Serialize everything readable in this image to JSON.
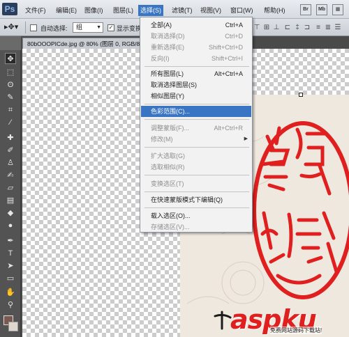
{
  "app": {
    "logo": "Ps"
  },
  "menubar": {
    "items": [
      "文件(F)",
      "编辑(E)",
      "图像(I)",
      "图层(L)",
      "选择(S)",
      "滤镜(T)",
      "视图(V)",
      "窗口(W)",
      "帮助(H)"
    ],
    "active_item": "选择(S)",
    "right_icons": [
      "Br",
      "Mb"
    ]
  },
  "options_bar": {
    "auto_select_label": "自动选择:",
    "group_select_value": "组",
    "show_transform_label": "显示变换控件",
    "show_transform_checked": true,
    "auto_select_checked": false
  },
  "document": {
    "tab_title": "80bOOOPICde.jpg @ 80% (图层 0, RGB/8)"
  },
  "select_menu": {
    "items": [
      {
        "label": "全部(A)",
        "shortcut": "Ctrl+A",
        "enabled": true
      },
      {
        "label": "取消选择(D)",
        "shortcut": "Ctrl+D",
        "enabled": false
      },
      {
        "label": "重新选择(E)",
        "shortcut": "Shift+Ctrl+D",
        "enabled": false
      },
      {
        "label": "反向(I)",
        "shortcut": "Shift+Ctrl+I",
        "enabled": false
      },
      {
        "label": "所有图层(L)",
        "shortcut": "Alt+Ctrl+A",
        "enabled": true
      },
      {
        "label": "取消选择图层(S)",
        "shortcut": "",
        "enabled": true
      },
      {
        "label": "相似图层(Y)",
        "shortcut": "",
        "enabled": true
      },
      {
        "label": "色彩范围(C)...",
        "shortcut": "",
        "enabled": true,
        "highlighted": true
      },
      {
        "label": "调整蒙版(F)...",
        "shortcut": "Alt+Ctrl+R",
        "enabled": false
      },
      {
        "label": "修改(M)",
        "shortcut": "",
        "enabled": false,
        "submenu": true
      },
      {
        "label": "扩大选取(G)",
        "shortcut": "",
        "enabled": false
      },
      {
        "label": "选取相似(R)",
        "shortcut": "",
        "enabled": false
      },
      {
        "label": "变换选区(T)",
        "shortcut": "",
        "enabled": false
      },
      {
        "label": "在快速蒙版模式下编辑(Q)",
        "shortcut": "",
        "enabled": true
      },
      {
        "label": "载入选区(O)...",
        "shortcut": "",
        "enabled": true
      },
      {
        "label": "存储选区(V)...",
        "shortcut": "",
        "enabled": false
      }
    ]
  },
  "watermark": {
    "logo": "aspku",
    "tagline": "免费网站源码下载站!"
  },
  "colors": {
    "foreground": "#7a5a4e",
    "background": "#e0d8cf",
    "menu_highlight": "#3a75c4",
    "seal_red": "#e01f1f"
  }
}
